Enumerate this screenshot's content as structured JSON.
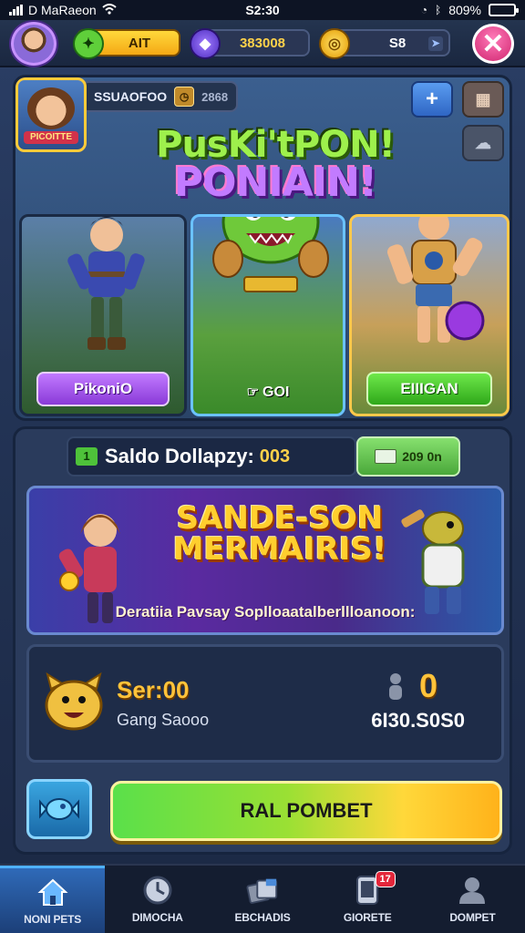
{
  "status_bar": {
    "carrier": "D MaRaeon",
    "time": "S2:30",
    "battery_percent": "809%",
    "battery_level": 0.85
  },
  "resources": {
    "cash": "AIT",
    "gems": "383008",
    "gold": "S8"
  },
  "profile": {
    "name": "SSUAOFOO",
    "number": "2868",
    "tag": "PICOITTE"
  },
  "hero": {
    "title_line1": "PusKi'tPON!",
    "title_line2": "PONIAIN!",
    "cards": [
      {
        "label": "PikoniO"
      },
      {
        "label": "GOI"
      },
      {
        "label": "EIIIGAN"
      }
    ]
  },
  "balance": {
    "lead_icon": "1",
    "title": "Saldo Dollapzy:",
    "value": "003",
    "cash_label": "209 0n"
  },
  "promo": {
    "title_line1": "SANDE-SON",
    "title_line2": "MERMAIRIS!",
    "subtitle": "Deratiia Pavsay Soplloaatalberllloanoon:"
  },
  "stats": {
    "main_value": "Ser:00",
    "sub_label": "Gang Saooo",
    "right_value": "0",
    "right_total": "6I30.S0S0"
  },
  "actions": {
    "play_label": "RAL POMBET"
  },
  "nav": {
    "items": [
      {
        "label": "NONI PETS",
        "icon": "home-icon"
      },
      {
        "label": "DIMOCHA",
        "icon": "clock-icon"
      },
      {
        "label": "EBCHADIS",
        "icon": "cards-icon"
      },
      {
        "label": "GIORETE",
        "icon": "phone-icon",
        "badge": "17"
      },
      {
        "label": "DOMPET",
        "icon": "user-icon"
      }
    ]
  },
  "colors": {
    "accent_gold": "#ffc33a",
    "accent_green": "#5ae04a",
    "accent_purple": "#c17aff",
    "close_pink": "#d02670"
  }
}
